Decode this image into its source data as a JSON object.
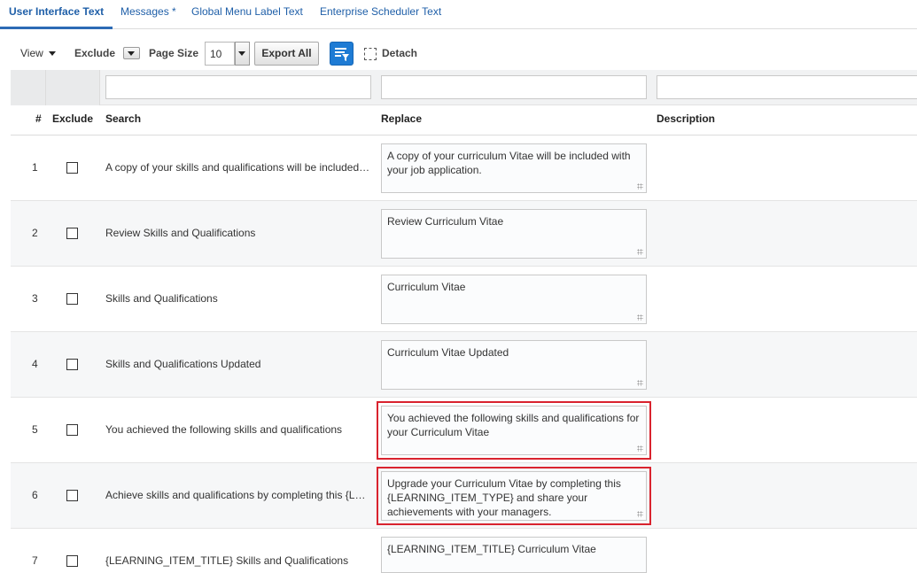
{
  "tabs": [
    {
      "label": "User Interface Text",
      "active": true
    },
    {
      "label": "Messages *",
      "active": false
    },
    {
      "label": "Global Menu Label Text",
      "active": false
    },
    {
      "label": "Enterprise Scheduler Text",
      "active": false
    }
  ],
  "toolbar": {
    "view_label": "View",
    "exclude_label": "Exclude",
    "page_size_label": "Page Size",
    "page_size_value": "10",
    "export_label": "Export All",
    "detach_label": "Detach"
  },
  "table": {
    "columns": {
      "num": "#",
      "exclude": "Exclude",
      "search": "Search",
      "replace": "Replace",
      "description": "Description"
    },
    "rows": [
      {
        "num": "1",
        "search": "A copy of your skills and qualifications will be included with your job application.",
        "replace": "A copy of your curriculum Vitae will be included with your job application.",
        "highlighted": false
      },
      {
        "num": "2",
        "search": "Review Skills and Qualifications",
        "replace": "Review Curriculum Vitae",
        "highlighted": false
      },
      {
        "num": "3",
        "search": "Skills and Qualifications",
        "replace": "Curriculum Vitae",
        "highlighted": false
      },
      {
        "num": "4",
        "search": "Skills and Qualifications Updated",
        "replace": "Curriculum Vitae Updated",
        "highlighted": false
      },
      {
        "num": "5",
        "search": "You achieved the following skills and qualifications",
        "replace": "You achieved the following skills and qualifications for your Curriculum Vitae",
        "highlighted": true
      },
      {
        "num": "6",
        "search": "Achieve skills and qualifications by completing this {LEARNING_ITEM_TYPE}",
        "replace": "Upgrade your Curriculum Vitae by completing this {LEARNING_ITEM_TYPE} and share your achievements with your managers.",
        "highlighted": true
      },
      {
        "num": "7",
        "search": "{LEARNING_ITEM_TITLE} Skills and Qualifications",
        "replace": "{LEARNING_ITEM_TITLE} Curriculum Vitae",
        "highlighted": false
      }
    ]
  },
  "colors": {
    "accent": "#1f5fa8",
    "highlight": "#d9232e",
    "filter_button": "#1e7bd4"
  }
}
